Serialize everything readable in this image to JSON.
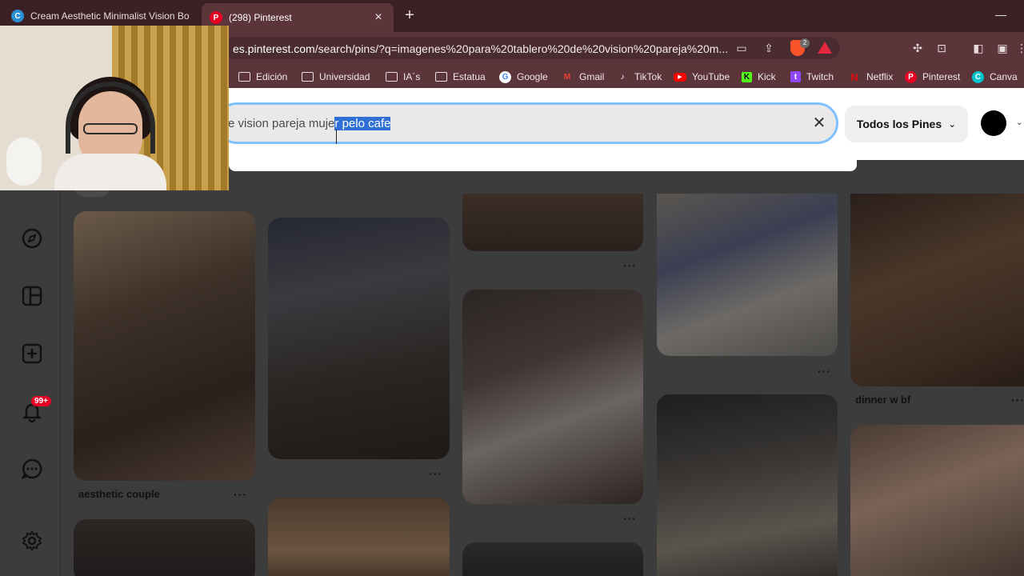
{
  "browser": {
    "tabs": [
      {
        "title": "Cream Aesthetic Minimalist Vision Bo",
        "favicon": "canva-icon"
      },
      {
        "title": "(298) Pinterest",
        "favicon": "pinterest-icon",
        "active": true
      }
    ],
    "url_host": "es.pinterest.com",
    "url_path": "/search/pins/?q=imagenes%20para%20tablero%20de%20vision%20pareja%20m...",
    "brave_badge": "2",
    "bookmarks": [
      {
        "label": "Edición",
        "icon": "folder-icon"
      },
      {
        "label": "Universidad",
        "icon": "folder-icon"
      },
      {
        "label": "IA´s",
        "icon": "folder-icon"
      },
      {
        "label": "Estatua",
        "icon": "folder-icon"
      },
      {
        "label": "Google",
        "icon": "google-icon"
      },
      {
        "label": "Gmail",
        "icon": "gmail-icon"
      },
      {
        "label": "TikTok",
        "icon": "tiktok-icon"
      },
      {
        "label": "YouTube",
        "icon": "youtube-icon"
      },
      {
        "label": "Kick",
        "icon": "kick-icon"
      },
      {
        "label": "Twitch",
        "icon": "twitch-icon"
      },
      {
        "label": "Netflix",
        "icon": "netflix-icon"
      },
      {
        "label": "Pinterest",
        "icon": "pinterest-icon"
      },
      {
        "label": "Canva",
        "icon": "canva-icon"
      }
    ]
  },
  "search": {
    "text_before": "e vision pareja muje",
    "text_selected": "r pelo cafe"
  },
  "filter": {
    "label": "Todos los Pines"
  },
  "sidebar": {
    "notifications_badge": "99+",
    "items": [
      "explore-icon",
      "boards-icon",
      "create-icon",
      "bell-icon",
      "messages-icon",
      "settings-icon"
    ]
  },
  "pins": {
    "labels": {
      "aesthetic_couple": "aesthetic couple",
      "dinner_w_bf": "dinner w bf"
    },
    "more": "···"
  },
  "colors": {
    "pinterest_red": "#e60023",
    "selection": "#2f6fd6",
    "search_focus": "#7fc1ff"
  }
}
